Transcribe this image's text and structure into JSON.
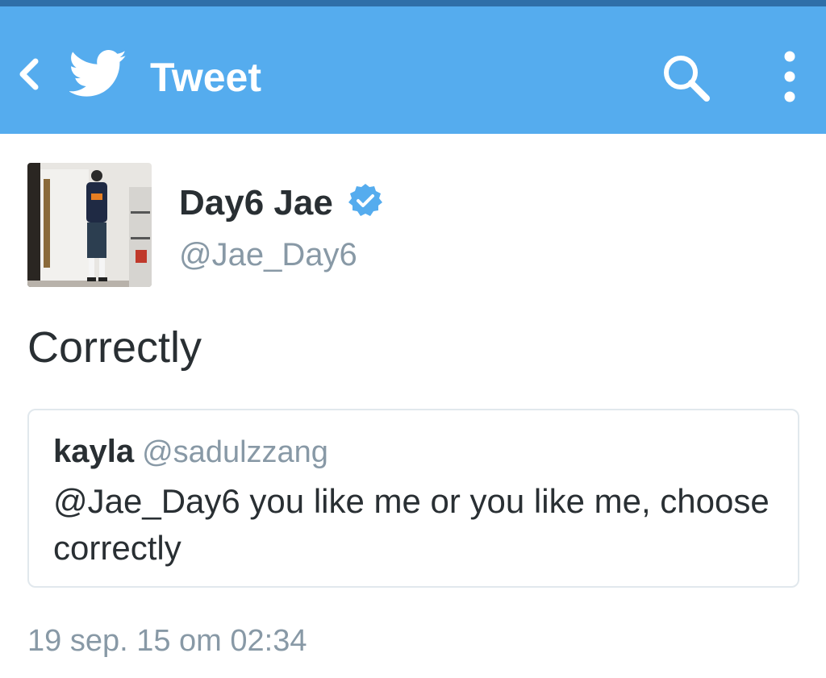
{
  "appbar": {
    "title": "Tweet",
    "back_icon": "chevron-left-icon",
    "logo_icon": "twitter-bird-icon",
    "search_icon": "search-icon",
    "more_icon": "more-vertical-icon",
    "background_color": "#55acee"
  },
  "tweet": {
    "author_name": "Day6 Jae",
    "author_handle": "@Jae_Day6",
    "verified": true,
    "text": "Correctly",
    "timestamp": "19 sep. 15 om 02:34"
  },
  "quoted_tweet": {
    "author_name": "kayla",
    "author_handle": "@sadulzzang",
    "text": "@Jae_Day6 you like me or you like me, choose correctly"
  },
  "colors": {
    "accent": "#55acee",
    "secondary_text": "#8899a6",
    "primary_text": "#292f33",
    "border": "#e1e8ed"
  }
}
